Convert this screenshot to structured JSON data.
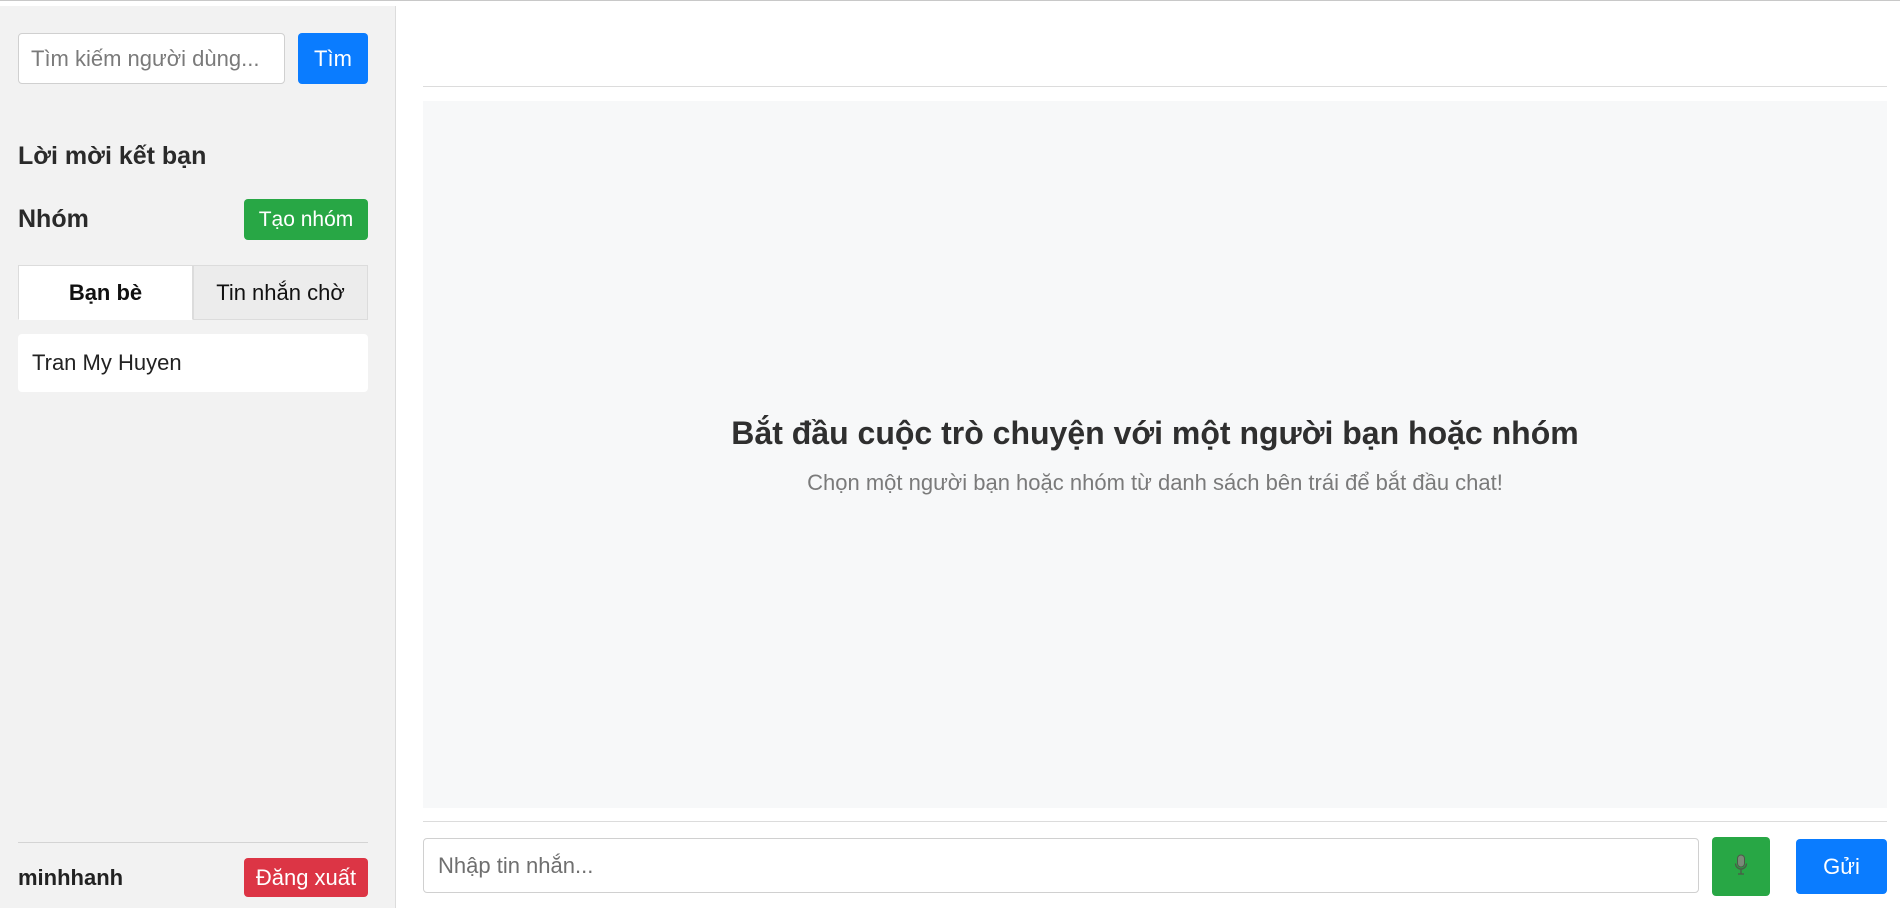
{
  "sidebar": {
    "search": {
      "placeholder": "Tìm kiếm người dùng...",
      "value": "",
      "button_label": "Tìm"
    },
    "invites_title": "Lời mời kết bạn",
    "groups_title": "Nhóm",
    "create_group_label": "Tạo nhóm",
    "tabs": [
      {
        "label": "Bạn bè",
        "active": true
      },
      {
        "label": "Tin nhắn chờ",
        "active": false
      }
    ],
    "friends": [
      {
        "name": "Tran My Huyen"
      }
    ],
    "footer": {
      "username": "minhhanh",
      "logout_label": "Đăng xuất"
    }
  },
  "main": {
    "welcome_title": "Bắt đầu cuộc trò chuyện với một người bạn hoặc nhóm",
    "welcome_subtitle": "Chọn một người bạn hoặc nhóm từ danh sách bên trái để bắt đầu chat!",
    "composer": {
      "placeholder": "Nhập tin nhắn...",
      "value": "",
      "mic_icon": "microphone-icon",
      "send_label": "Gửi"
    }
  },
  "colors": {
    "primary": "#0a7cff",
    "success": "#28a745",
    "danger": "#dc3545",
    "sidebar_bg": "#f2f2f2",
    "chat_bg": "#f7f8f9"
  }
}
